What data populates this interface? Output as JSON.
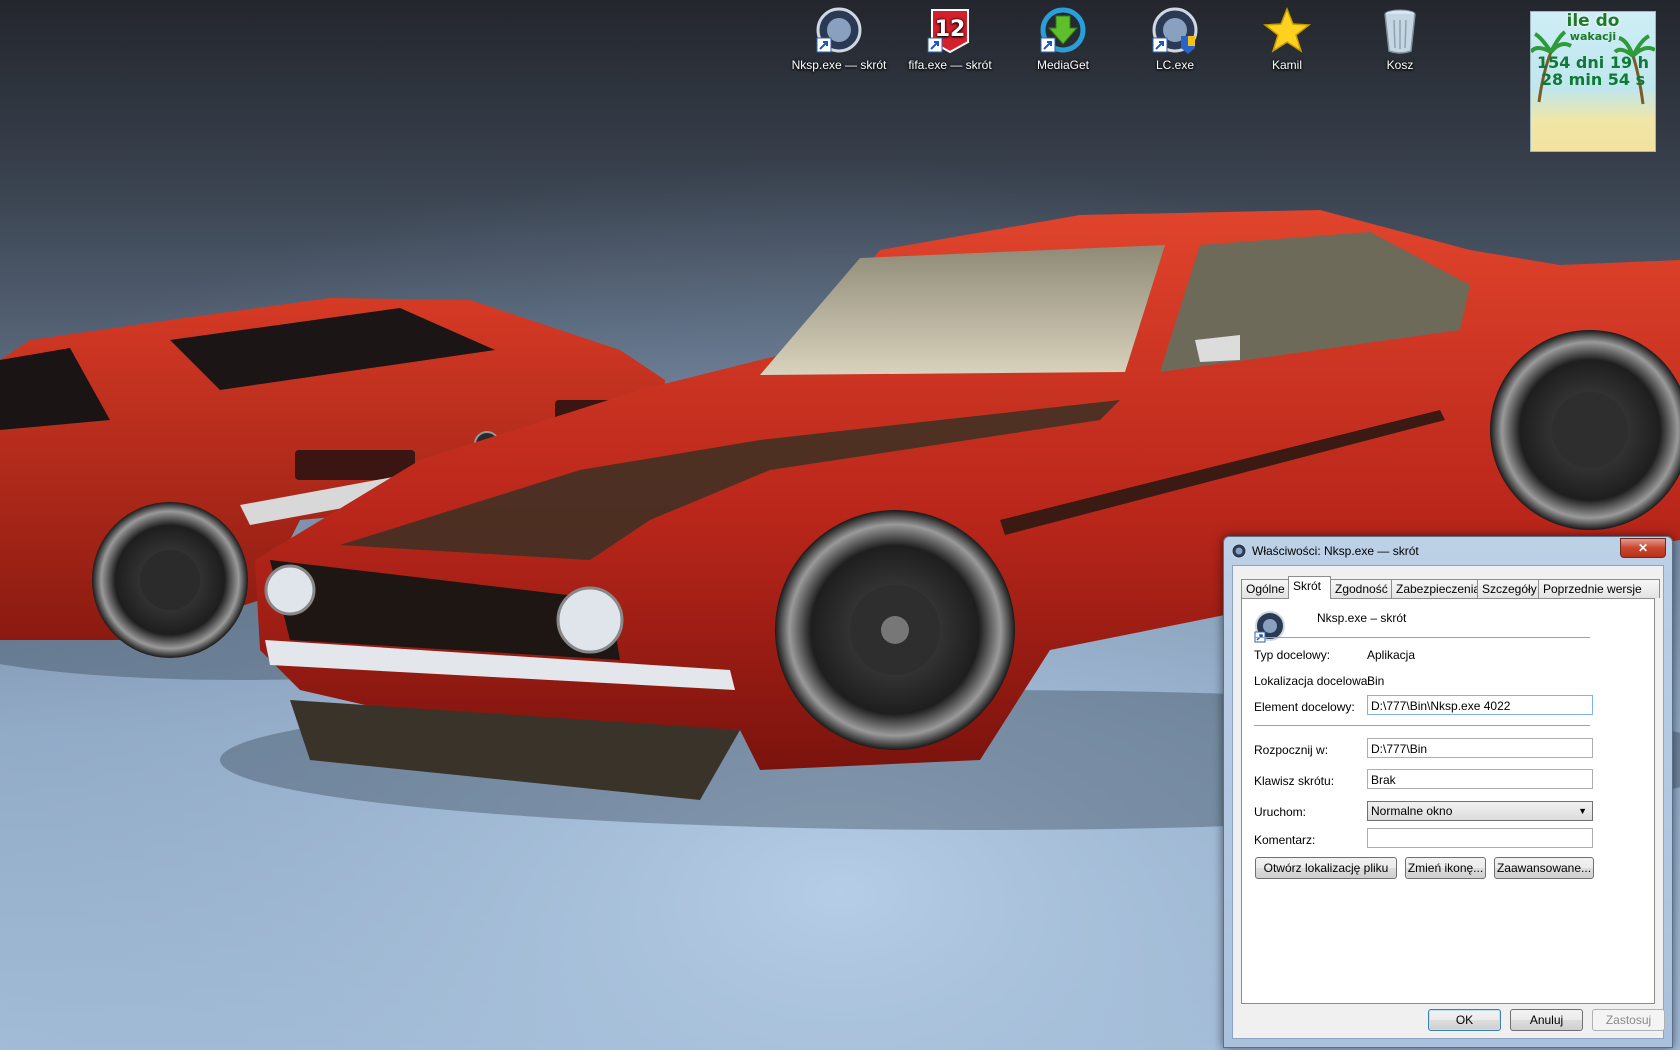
{
  "desktop": {
    "icons": [
      {
        "label": "Nksp.exe — skrót",
        "icon": "nksp-app-icon",
        "shortcut": true
      },
      {
        "label": "fifa.exe — skrót",
        "icon": "fifa12-icon",
        "shortcut": true
      },
      {
        "label": "MediaGet",
        "icon": "mediaget-download-icon",
        "shortcut": true
      },
      {
        "label": "LC.exe",
        "icon": "lc-app-icon",
        "shortcut": true
      },
      {
        "label": "Kamil",
        "icon": "star-icon",
        "shortcut": false
      },
      {
        "label": "Kosz",
        "icon": "recycle-bin-icon",
        "shortcut": false
      }
    ]
  },
  "gadget": {
    "title": "ile do",
    "subtitle": "wakacji",
    "line1": "154 dni 19 h",
    "line2": "28 min 54 s"
  },
  "dialog": {
    "title": "Właściwości: Nksp.exe — skrót",
    "close_label": "✕",
    "tabs": [
      "Ogólne",
      "Skrót",
      "Zgodność",
      "Zabezpieczenia",
      "Szczegóły",
      "Poprzednie wersje"
    ],
    "active_tab": "Skrót",
    "shortcut_name": "Nksp.exe – skrót",
    "fields": {
      "target_type_label": "Typ docelowy:",
      "target_type_value": "Aplikacja",
      "target_location_label": "Lokalizacja docelowa:",
      "target_location_value": "Bin",
      "target_label": "Element docelowy:",
      "target_value": "D:\\777\\Bin\\Nksp.exe 4022",
      "start_in_label": "Rozpocznij w:",
      "start_in_value": "D:\\777\\Bin",
      "hotkey_label": "Klawisz skrótu:",
      "hotkey_value": "Brak",
      "run_label": "Uruchom:",
      "run_value": "Normalne okno",
      "comment_label": "Komentarz:",
      "comment_value": ""
    },
    "buttons": {
      "open_location": "Otwórz lokalizację pliku",
      "change_icon": "Zmień ikonę...",
      "advanced": "Zaawansowane...",
      "ok": "OK",
      "cancel": "Anuluj",
      "apply": "Zastosuj"
    }
  },
  "colors": {
    "car_red": "#c1301c",
    "dialog_frame": "#b3c9e3",
    "close_red": "#c9462f",
    "gadget_text": "#1d7a2a"
  }
}
